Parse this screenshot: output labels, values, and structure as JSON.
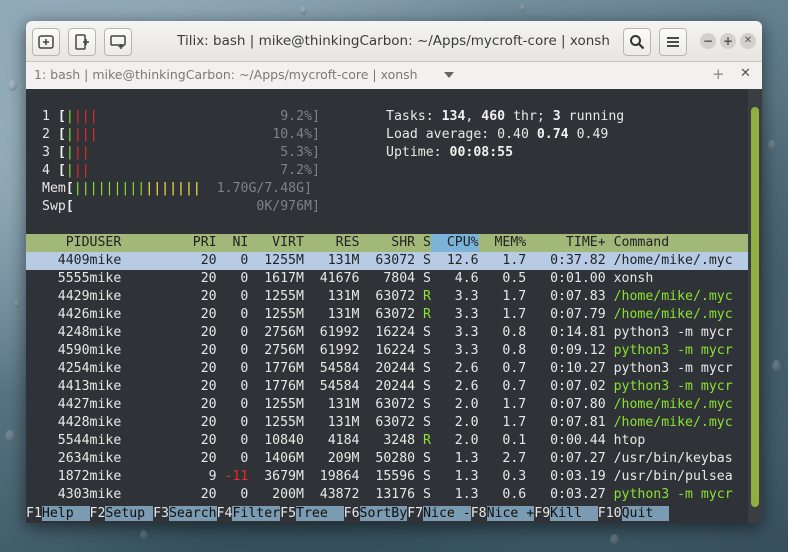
{
  "window": {
    "title": "Tilix: bash | mike@thinkingCarbon: ~/Apps/mycroft-core | xonsh",
    "tab_title": "1: bash | mike@thinkingCarbon: ~/Apps/mycroft-core | xonsh",
    "tab_add": "+",
    "tab_close": "✕",
    "min": "−",
    "max": "+",
    "close": "✕"
  },
  "meters": {
    "cpu": [
      {
        "label": "1",
        "value": "9.2%]",
        "green": "|",
        "red": "|||"
      },
      {
        "label": "2",
        "value": "10.4%]",
        "green": "|",
        "red": "|||"
      },
      {
        "label": "3",
        "value": "5.3%]",
        "green": "|",
        "red": "||"
      },
      {
        "label": "4",
        "value": "7.2%]",
        "green": "|",
        "red": "||"
      }
    ],
    "mem": {
      "label": "Mem",
      "value": "1.70G/7.48G]"
    },
    "swp": {
      "label": "Swp",
      "value": "0K/976M]"
    }
  },
  "summary": {
    "tasks_label": "Tasks:",
    "tasks": "134",
    "sep1": ",",
    "threads": "460",
    "thr_label": " thr;",
    "running": "3",
    "running_label": " running",
    "load_label": "Load average:",
    "load1": "0.40",
    "load5": "0.74",
    "load15": "0.49",
    "uptime_label": "Uptime:",
    "uptime": "00:08:55"
  },
  "columns": [
    "PID",
    "USER",
    "PRI",
    "NI",
    "VIRT",
    "RES",
    "SHR",
    "S",
    "CPU%",
    "MEM%",
    "TIME+",
    "Command"
  ],
  "processes": [
    {
      "pid": "4409",
      "user": "mike",
      "pri": "20",
      "ni": "0",
      "virt": "1255M",
      "res": "131M",
      "shr": "63072",
      "s": "S",
      "cpu": "12.6",
      "mem": "1.7",
      "time": "0:37.82",
      "cmd": "/home/mike/.myc",
      "thread": false
    },
    {
      "pid": "5555",
      "user": "mike",
      "pri": "20",
      "ni": "0",
      "virt": "1617M",
      "res": "41676",
      "shr": "7804",
      "s": "S",
      "cpu": "4.6",
      "mem": "0.5",
      "time": "0:01.00",
      "cmd": "xonsh",
      "thread": false
    },
    {
      "pid": "4429",
      "user": "mike",
      "pri": "20",
      "ni": "0",
      "virt": "1255M",
      "res": "131M",
      "shr": "63072",
      "s": "R",
      "cpu": "3.3",
      "mem": "1.7",
      "time": "0:07.83",
      "cmd": "/home/mike/.myc",
      "thread": true
    },
    {
      "pid": "4426",
      "user": "mike",
      "pri": "20",
      "ni": "0",
      "virt": "1255M",
      "res": "131M",
      "shr": "63072",
      "s": "R",
      "cpu": "3.3",
      "mem": "1.7",
      "time": "0:07.79",
      "cmd": "/home/mike/.myc",
      "thread": true
    },
    {
      "pid": "4248",
      "user": "mike",
      "pri": "20",
      "ni": "0",
      "virt": "2756M",
      "res": "61992",
      "shr": "16224",
      "s": "S",
      "cpu": "3.3",
      "mem": "0.8",
      "time": "0:14.81",
      "cmd": "python3 -m mycr",
      "thread": false
    },
    {
      "pid": "4590",
      "user": "mike",
      "pri": "20",
      "ni": "0",
      "virt": "2756M",
      "res": "61992",
      "shr": "16224",
      "s": "S",
      "cpu": "3.3",
      "mem": "0.8",
      "time": "0:09.12",
      "cmd": "python3 -m mycr",
      "thread": true
    },
    {
      "pid": "4254",
      "user": "mike",
      "pri": "20",
      "ni": "0",
      "virt": "1776M",
      "res": "54584",
      "shr": "20244",
      "s": "S",
      "cpu": "2.6",
      "mem": "0.7",
      "time": "0:10.27",
      "cmd": "python3 -m mycr",
      "thread": false
    },
    {
      "pid": "4413",
      "user": "mike",
      "pri": "20",
      "ni": "0",
      "virt": "1776M",
      "res": "54584",
      "shr": "20244",
      "s": "S",
      "cpu": "2.6",
      "mem": "0.7",
      "time": "0:07.02",
      "cmd": "python3 -m mycr",
      "thread": true
    },
    {
      "pid": "4427",
      "user": "mike",
      "pri": "20",
      "ni": "0",
      "virt": "1255M",
      "res": "131M",
      "shr": "63072",
      "s": "S",
      "cpu": "2.0",
      "mem": "1.7",
      "time": "0:07.80",
      "cmd": "/home/mike/.myc",
      "thread": true
    },
    {
      "pid": "4428",
      "user": "mike",
      "pri": "20",
      "ni": "0",
      "virt": "1255M",
      "res": "131M",
      "shr": "63072",
      "s": "S",
      "cpu": "2.0",
      "mem": "1.7",
      "time": "0:07.81",
      "cmd": "/home/mike/.myc",
      "thread": true
    },
    {
      "pid": "5544",
      "user": "mike",
      "pri": "20",
      "ni": "0",
      "virt": "10840",
      "res": "4184",
      "shr": "3248",
      "s": "R",
      "cpu": "2.0",
      "mem": "0.1",
      "time": "0:00.44",
      "cmd": "htop",
      "thread": false
    },
    {
      "pid": "2634",
      "user": "mike",
      "pri": "20",
      "ni": "0",
      "virt": "1406M",
      "res": "209M",
      "shr": "50280",
      "s": "S",
      "cpu": "1.3",
      "mem": "2.7",
      "time": "0:07.27",
      "cmd": "/usr/bin/keybas",
      "thread": false
    },
    {
      "pid": "1872",
      "user": "mike",
      "pri": "9",
      "ni": "-11",
      "virt": "3679M",
      "res": "19864",
      "shr": "15596",
      "s": "S",
      "cpu": "1.3",
      "mem": "0.3",
      "time": "0:03.19",
      "cmd": "/usr/bin/pulsea",
      "thread": false
    },
    {
      "pid": "4303",
      "user": "mike",
      "pri": "20",
      "ni": "0",
      "virt": "200M",
      "res": "43872",
      "shr": "13176",
      "s": "S",
      "cpu": "1.3",
      "mem": "0.6",
      "time": "0:03.27",
      "cmd": "python3 -m mycr",
      "thread": true
    }
  ],
  "function_keys": [
    {
      "key": "F1",
      "label": "Help  "
    },
    {
      "key": "F2",
      "label": "Setup "
    },
    {
      "key": "F3",
      "label": "Search"
    },
    {
      "key": "F4",
      "label": "Filter"
    },
    {
      "key": "F5",
      "label": "Tree  "
    },
    {
      "key": "F6",
      "label": "SortBy"
    },
    {
      "key": "F7",
      "label": "Nice -"
    },
    {
      "key": "F8",
      "label": "Nice +"
    },
    {
      "key": "F9",
      "label": "Kill  "
    },
    {
      "key": "F10",
      "label": "Quit  "
    }
  ],
  "colors": {
    "header_bg": "#a2b878",
    "selected_bg": "#b8cbe5",
    "thread_fg": "#8ae234",
    "accent": "#8fb040"
  },
  "icons": [
    "add-terminal-icon",
    "split-vertical-icon",
    "split-horizontal-icon",
    "search-icon",
    "hamburger-menu-icon",
    "dropdown-icon"
  ]
}
